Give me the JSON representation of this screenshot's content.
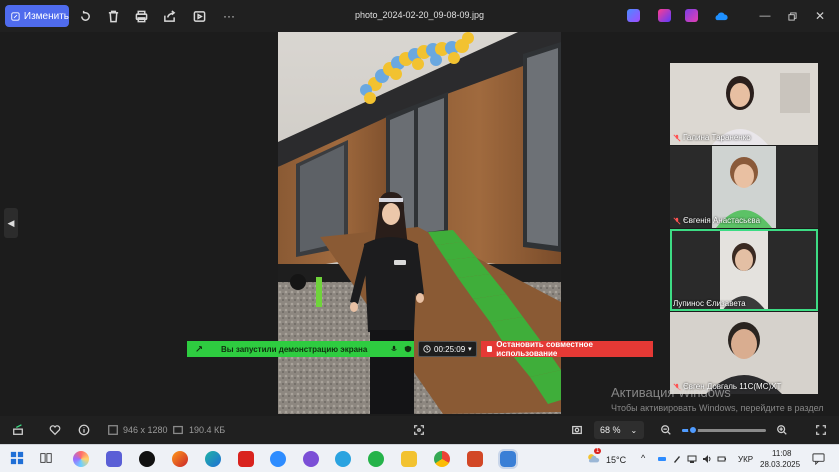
{
  "toolbar": {
    "edit_label": "Изменить",
    "filename": "photo_2024-02-20_09-08-09.jpg",
    "more_label": "···"
  },
  "meeting": {
    "participants": [
      {
        "name": "Галина Тараненко",
        "muted": true
      },
      {
        "name": "Євгенія Анастасьєва",
        "muted": true
      },
      {
        "name": "Лупинос Єлизавета",
        "muted": false,
        "active": true
      },
      {
        "name": "Євген Довгаль 11С(МС)ХТ",
        "muted": true
      }
    ]
  },
  "share_bar": {
    "message": "Вы запустили демонстрацию экрана",
    "timer": "00:25:09",
    "stop_label": "Остановить совместное использование"
  },
  "watermark": {
    "title": "Активация Windows",
    "subtitle": "Чтобы активировать Windows, перейдите в раздел \"Параметры\"."
  },
  "statusbar": {
    "dimensions": "946 x 1280",
    "file_size": "190.4 КБ",
    "zoom": "68 %",
    "zoom_level_percent": 68
  },
  "taskbar": {
    "temperature": "15°C",
    "weather_badge": "1",
    "language": "УКР",
    "time": "11:08",
    "date": "28.03.2025"
  },
  "colors": {
    "accent": "#4f6bed",
    "share_green": "#2ecc40",
    "stop_red": "#e53935",
    "active_tile": "#3ddc84"
  }
}
